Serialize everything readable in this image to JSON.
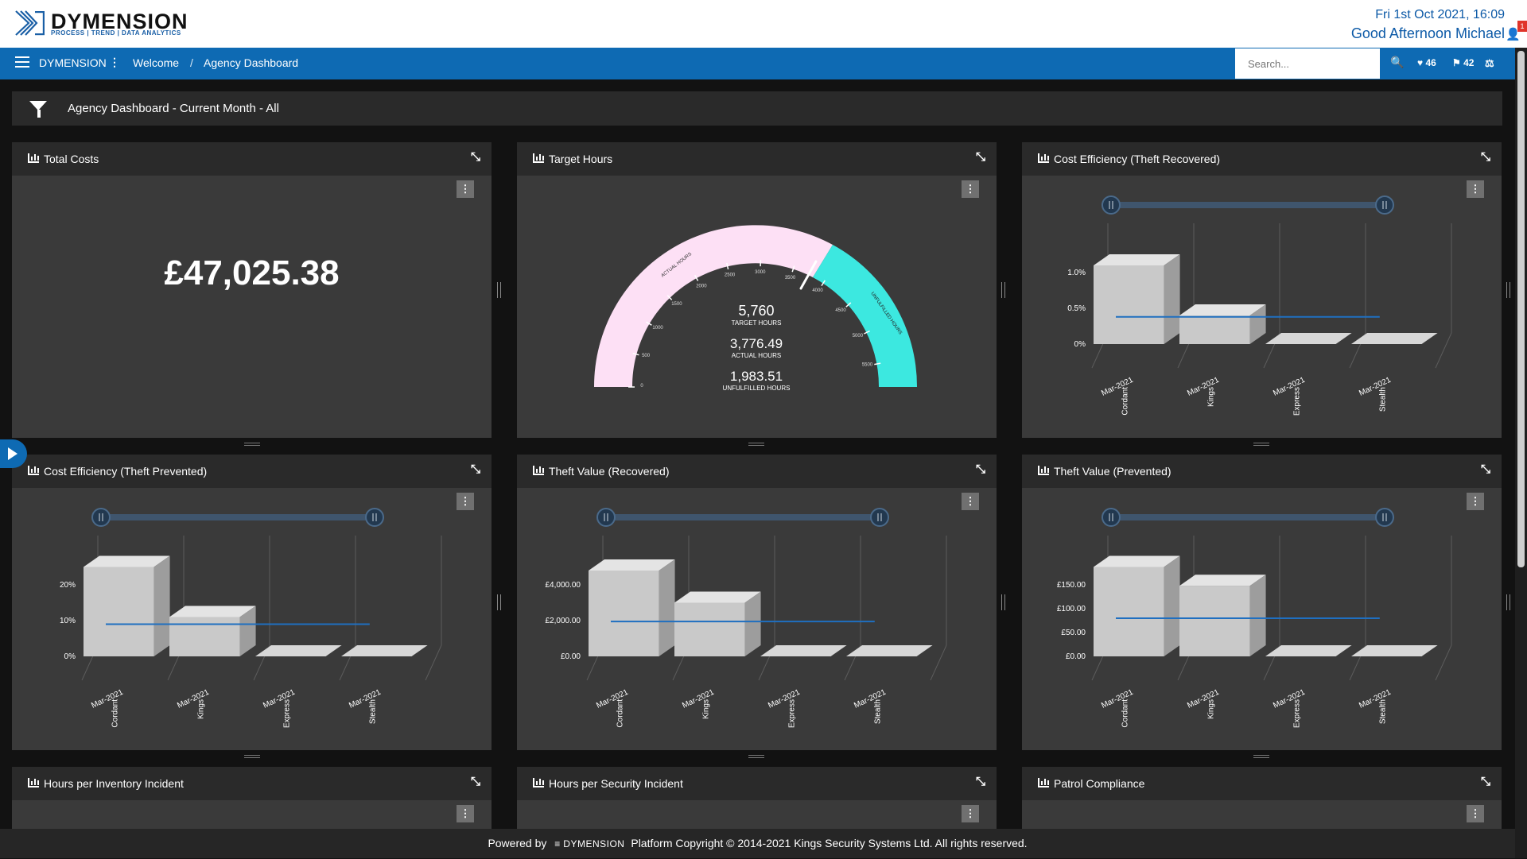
{
  "header": {
    "logo_name": "DYMENSION",
    "logo_tagline": "PROCESS | TREND | DATA ANALYTICS",
    "datetime": "Fri 1st Oct 2021, 16:09",
    "greeting": "Good Afternoon Michael",
    "notification_count": "1"
  },
  "nav": {
    "brand": "DYMENSION",
    "breadcrumb": [
      "Welcome",
      "Agency Dashboard"
    ],
    "breadcrumb_sep": "/",
    "search_placeholder": "Search...",
    "favourites_count": "46",
    "tags_count": "42"
  },
  "filter_bar": {
    "title": "Agency Dashboard - Current Month - All"
  },
  "panels": {
    "total_costs": {
      "title": "Total Costs",
      "value": "£47,025.38"
    },
    "target_hours": {
      "title": "Target Hours",
      "target": "5,760",
      "target_label": "TARGET HOURS",
      "actual": "3,776.49",
      "actual_label": "ACTUAL HOURS",
      "unfulfilled": "1,983.51",
      "unfulfilled_label": "UNFULFILLED HOURS",
      "band_actual": "ACTUAL HOURS",
      "band_unfulfilled": "UNFULFILLED HOURS",
      "ticks": [
        "0",
        "500",
        "1000",
        "1500",
        "2000",
        "2500",
        "3000",
        "3500",
        "4000",
        "4500",
        "5000",
        "5500"
      ]
    },
    "cost_eff_recovered": {
      "title": "Cost Efficiency (Theft Recovered)"
    },
    "cost_eff_prevented": {
      "title": "Cost Efficiency (Theft Prevented)"
    },
    "theft_value_recovered": {
      "title": "Theft Value (Recovered)"
    },
    "theft_value_prevented": {
      "title": "Theft Value (Prevented)"
    },
    "hours_inventory": {
      "title": "Hours per Inventory Incident"
    },
    "hours_security": {
      "title": "Hours per Security Incident"
    },
    "patrol_compliance": {
      "title": "Patrol Compliance"
    }
  },
  "chart_data": [
    {
      "type": "bar",
      "title": "Cost Efficiency (Theft Recovered)",
      "categories": [
        "Mar-2021 Cordant",
        "Mar-2021 Kings",
        "Mar-2021 Express",
        "Mar-2021 Stealth"
      ],
      "x_date": "Mar-2021",
      "x_names": [
        "Cordant",
        "Kings",
        "Express",
        "Stealth"
      ],
      "values": [
        1.1,
        0.4,
        0,
        0
      ],
      "average": 0.38,
      "ylim": [
        0,
        1.0
      ],
      "yticks": [
        "0%",
        "0.5%",
        "1.0%"
      ]
    },
    {
      "type": "bar",
      "title": "Cost Efficiency (Theft Prevented)",
      "categories": [
        "Mar-2021 Cordant",
        "Mar-2021 Kings",
        "Mar-2021 Express",
        "Mar-2021 Stealth"
      ],
      "x_date": "Mar-2021",
      "x_names": [
        "Cordant",
        "Kings",
        "Express",
        "Stealth"
      ],
      "values": [
        25,
        11,
        0,
        0
      ],
      "average": 9,
      "ylim": [
        0,
        20
      ],
      "yticks": [
        "0%",
        "10%",
        "20%"
      ]
    },
    {
      "type": "bar",
      "title": "Theft Value (Recovered)",
      "categories": [
        "Mar-2021 Cordant",
        "Mar-2021 Kings",
        "Mar-2021 Express",
        "Mar-2021 Stealth"
      ],
      "x_date": "Mar-2021",
      "x_names": [
        "Cordant",
        "Kings",
        "Express",
        "Stealth"
      ],
      "values": [
        4800,
        3000,
        0,
        0
      ],
      "average": 1950,
      "ylim": [
        0,
        4000
      ],
      "yticks": [
        "£0.00",
        "£2,000.00",
        "£4,000.00"
      ]
    },
    {
      "type": "bar",
      "title": "Theft Value (Prevented)",
      "categories": [
        "Mar-2021 Cordant",
        "Mar-2021 Kings",
        "Mar-2021 Express",
        "Mar-2021 Stealth"
      ],
      "x_date": "Mar-2021",
      "x_names": [
        "Cordant",
        "Kings",
        "Express",
        "Stealth"
      ],
      "values": [
        197,
        148,
        0,
        0
      ],
      "average": 80,
      "ylim": [
        0,
        150
      ],
      "yticks": [
        "£0.00",
        "£50.00",
        "£100.00",
        "£150.00"
      ]
    }
  ],
  "footer": {
    "powered": "Powered by",
    "brand": "DYMENSION",
    "copyright": "Platform Copyright © 2014-2021 Kings Security Systems Ltd. All rights reserved."
  },
  "colors": {
    "nav": "#0e6ab3",
    "gauge_actual": "#fde0f5",
    "gauge_unfulfilled": "#3ce8e0",
    "avg_line": "#1f6fc0"
  }
}
